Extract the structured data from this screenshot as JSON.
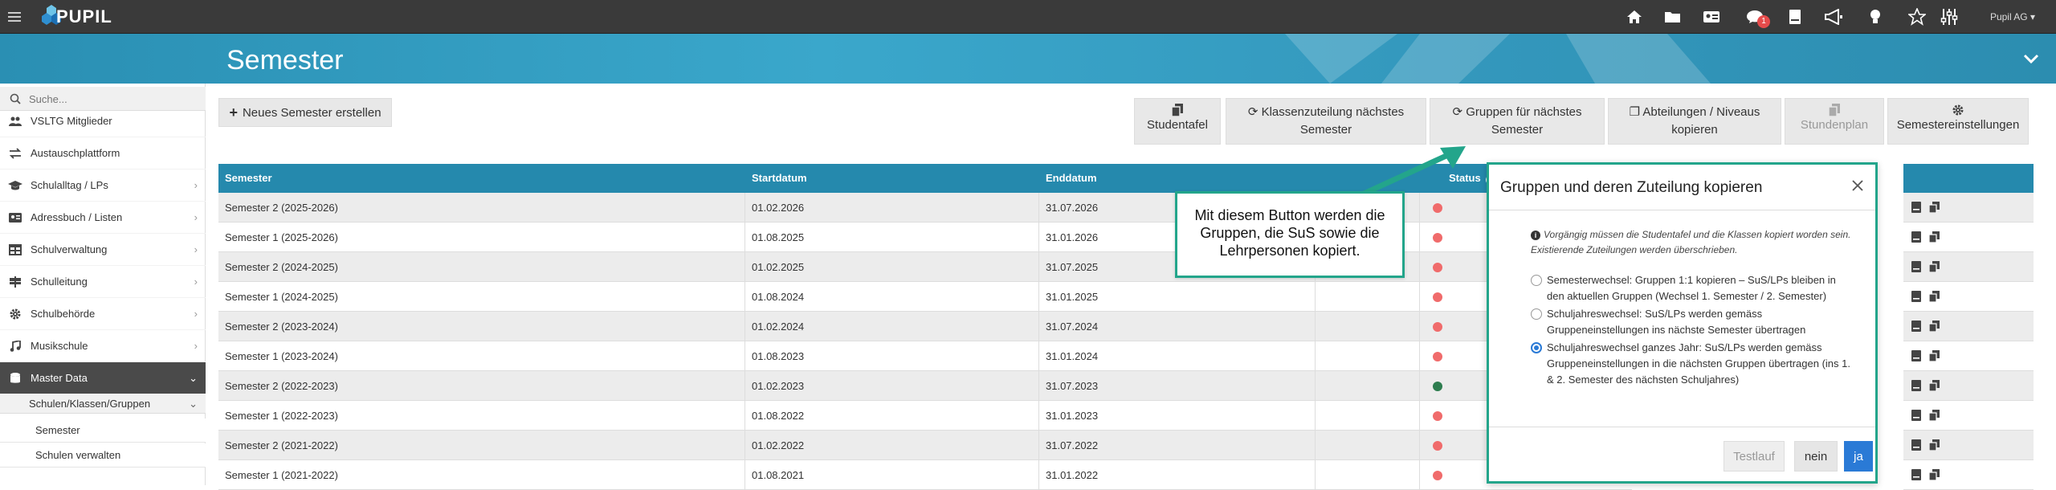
{
  "app": {
    "name": "PUPIL",
    "user_menu": "Pupil AG ▾",
    "notification_count": "1"
  },
  "header": {
    "title": "Semester"
  },
  "search": {
    "placeholder": "Suche..."
  },
  "sidebar": {
    "items": [
      {
        "label": "VSLTG Mitglieder",
        "icon": "users-icon",
        "chevron": false
      },
      {
        "label": "Austauschplattform",
        "icon": "exchange-icon",
        "chevron": false
      },
      {
        "label": "Schulalltag / LPs",
        "icon": "graduation-cap-icon",
        "chevron": true
      },
      {
        "label": "Adressbuch / Listen",
        "icon": "address-card-icon",
        "chevron": true
      },
      {
        "label": "Schulverwaltung",
        "icon": "table-icon",
        "chevron": true
      },
      {
        "label": "Schulleitung",
        "icon": "road-sign-icon",
        "chevron": true
      },
      {
        "label": "Schulbehörde",
        "icon": "gear-icon",
        "chevron": true
      },
      {
        "label": "Musikschule",
        "icon": "music-icon",
        "chevron": true
      },
      {
        "label": "Master Data",
        "icon": "database-icon",
        "chevron": true,
        "active": true
      }
    ],
    "submenu": {
      "label": "Schulen/Klassen/Gruppen",
      "children": [
        "Semester",
        "Schulen verwalten"
      ]
    }
  },
  "toolbar": {
    "new_semester": "Neues Semester erstellen",
    "studentafel": "Studentafel",
    "klassenzuteilung": [
      "Klassenzuteilung nächstes",
      "Semester"
    ],
    "gruppen": [
      "Gruppen für nächstes",
      "Semester"
    ],
    "abteilungen": [
      "Abteilungen / Niveaus",
      "kopieren"
    ],
    "stundenplan": "Stundenplan",
    "semestereinstellungen": "Semestereinstellungen"
  },
  "table": {
    "headers": [
      "Semester",
      "Startdatum",
      "Enddatum",
      "",
      "Status"
    ],
    "rows": [
      {
        "semester": "Semester 2 (2025-2026)",
        "start": "01.02.2026",
        "end": "31.07.2026",
        "status": "red"
      },
      {
        "semester": "Semester 1 (2025-2026)",
        "start": "01.08.2025",
        "end": "31.01.2026",
        "status": "red"
      },
      {
        "semester": "Semester 2 (2024-2025)",
        "start": "01.02.2025",
        "end": "31.07.2025",
        "status": "red"
      },
      {
        "semester": "Semester 1 (2024-2025)",
        "start": "01.08.2024",
        "end": "31.01.2025",
        "status": "red"
      },
      {
        "semester": "Semester 2 (2023-2024)",
        "start": "01.02.2024",
        "end": "31.07.2024",
        "status": "red"
      },
      {
        "semester": "Semester 1 (2023-2024)",
        "start": "01.08.2023",
        "end": "31.01.2024",
        "status": "red"
      },
      {
        "semester": "Semester 2 (2022-2023)",
        "start": "01.02.2023",
        "end": "31.07.2023",
        "status": "green"
      },
      {
        "semester": "Semester 1 (2022-2023)",
        "start": "01.08.2022",
        "end": "31.01.2023",
        "status": "red"
      },
      {
        "semester": "Semester 2 (2021-2022)",
        "start": "01.02.2022",
        "end": "31.07.2022",
        "status": "red"
      },
      {
        "semester": "Semester 1 (2021-2022)",
        "start": "01.08.2021",
        "end": "31.01.2022",
        "status": "red"
      }
    ]
  },
  "colors": {
    "status_red": "#f06b6b",
    "status_green": "#2e7d4f",
    "accent": "#2589ad",
    "highlight": "#23a58b",
    "primary": "#2a7ad6"
  },
  "modal": {
    "title": "Gruppen und deren Zuteilung kopieren",
    "info": "Vorgängig müssen die Studentafel und die Klassen kopiert worden sein. Existierende Zuteilungen werden überschrieben.",
    "options": [
      {
        "label": "Semesterwechsel: Gruppen 1:1 kopieren – SuS/LPs bleiben in den aktuellen Gruppen (Wechsel 1. Semester / 2. Semester)",
        "selected": false
      },
      {
        "label": "Schuljahreswechsel: SuS/LPs werden gemäss Gruppeneinstellungen ins nächste Semester übertragen",
        "selected": false
      },
      {
        "label": "Schuljahreswechsel ganzes Jahr: SuS/LPs werden gemäss Gruppeneinstellungen in die nächsten Gruppen übertragen (ins 1. & 2. Semester des nächsten Schuljahres)",
        "selected": true
      }
    ],
    "buttons": {
      "testlauf": "Testlauf",
      "nein": "nein",
      "ja": "ja"
    }
  },
  "callout": {
    "text": "Mit diesem Button werden die Gruppen, die SuS sowie die Lehrpersonen kopiert."
  }
}
